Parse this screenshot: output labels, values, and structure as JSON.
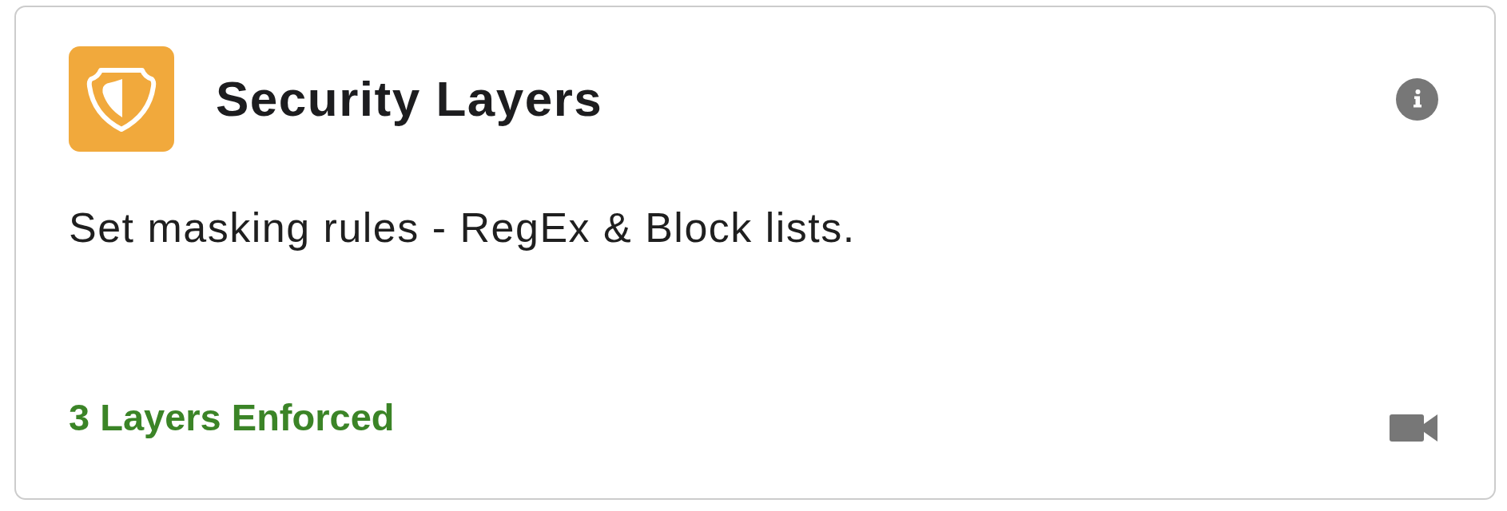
{
  "card": {
    "title": "Security Layers",
    "description": "Set masking rules - RegEx & Block lists.",
    "status": "3 Layers Enforced"
  }
}
